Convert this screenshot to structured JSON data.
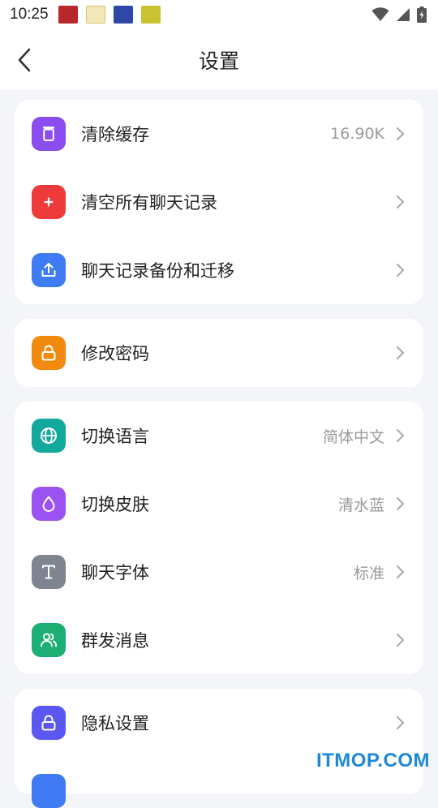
{
  "statusbar": {
    "time": "10:25",
    "notification_icons": [
      "app-notification-icon-1",
      "app-notification-icon-2",
      "app-notification-icon-3",
      "app-notification-icon-4"
    ],
    "system_icons": [
      "wifi-icon",
      "signal-icon",
      "battery-charging-icon"
    ]
  },
  "header": {
    "back_icon": "chevron-left-icon",
    "title": "设置"
  },
  "sections": [
    {
      "items": [
        {
          "label": "清除缓存",
          "value": "16.90K",
          "icon": "trash-icon",
          "color": "#8B4CF0"
        },
        {
          "label": "清空所有聊天记录",
          "value": "",
          "icon": "plus-icon",
          "color": "#EE3A3A"
        },
        {
          "label": "聊天记录备份和迁移",
          "value": "",
          "icon": "upload-icon",
          "color": "#3E7BF4"
        }
      ]
    },
    {
      "items": [
        {
          "label": "修改密码",
          "value": "",
          "icon": "lock-icon",
          "color": "#F18A0E"
        }
      ]
    },
    {
      "items": [
        {
          "label": "切换语言",
          "value": "简体中文",
          "icon": "globe-icon",
          "color": "#12A89B"
        },
        {
          "label": "切换皮肤",
          "value": "清水蓝",
          "icon": "droplet-icon",
          "color": "#9A53F2"
        },
        {
          "label": "聊天字体",
          "value": "标准",
          "icon": "text-icon",
          "color": "#7E8590"
        },
        {
          "label": "群发消息",
          "value": "",
          "icon": "users-icon",
          "color": "#1DAE73"
        }
      ]
    },
    {
      "items": [
        {
          "label": "隐私设置",
          "value": "",
          "icon": "lock-icon",
          "color": "#5B57F3"
        }
      ]
    }
  ],
  "watermark": "ITMOP.COM",
  "colors": {
    "background": "#F4F5F9",
    "card": "#FFFFFF",
    "value_text": "#9A9A9A",
    "chevron": "#A8A8A8"
  }
}
